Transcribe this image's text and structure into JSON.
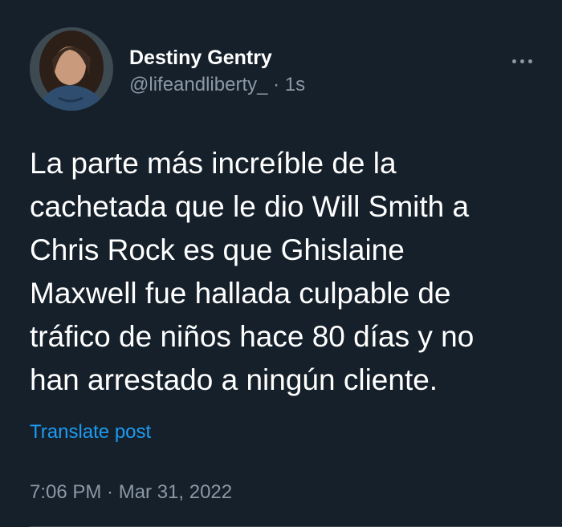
{
  "tweet": {
    "author": {
      "display_name": "Destiny Gentry",
      "handle": "@lifeandliberty_",
      "separator": "·",
      "relative_time": "1s"
    },
    "more_icon": "more-horizontal-icon",
    "text_lines": [
      "La parte más increíble de la",
      "cachetada que le dio Will Smith a",
      "Chris Rock es que Ghislaine",
      "Maxwell fue hallada culpable de",
      "tráfico de niños hace 80 días y no",
      "han arrestado a ningún cliente."
    ],
    "translate_label": "Translate post",
    "timestamp": "7:06 PM · Mar 31, 2022"
  },
  "colors": {
    "background": "#15202b",
    "primary_text": "#ffffff",
    "secondary_text": "#8b98a5",
    "link": "#1d9bf0"
  }
}
